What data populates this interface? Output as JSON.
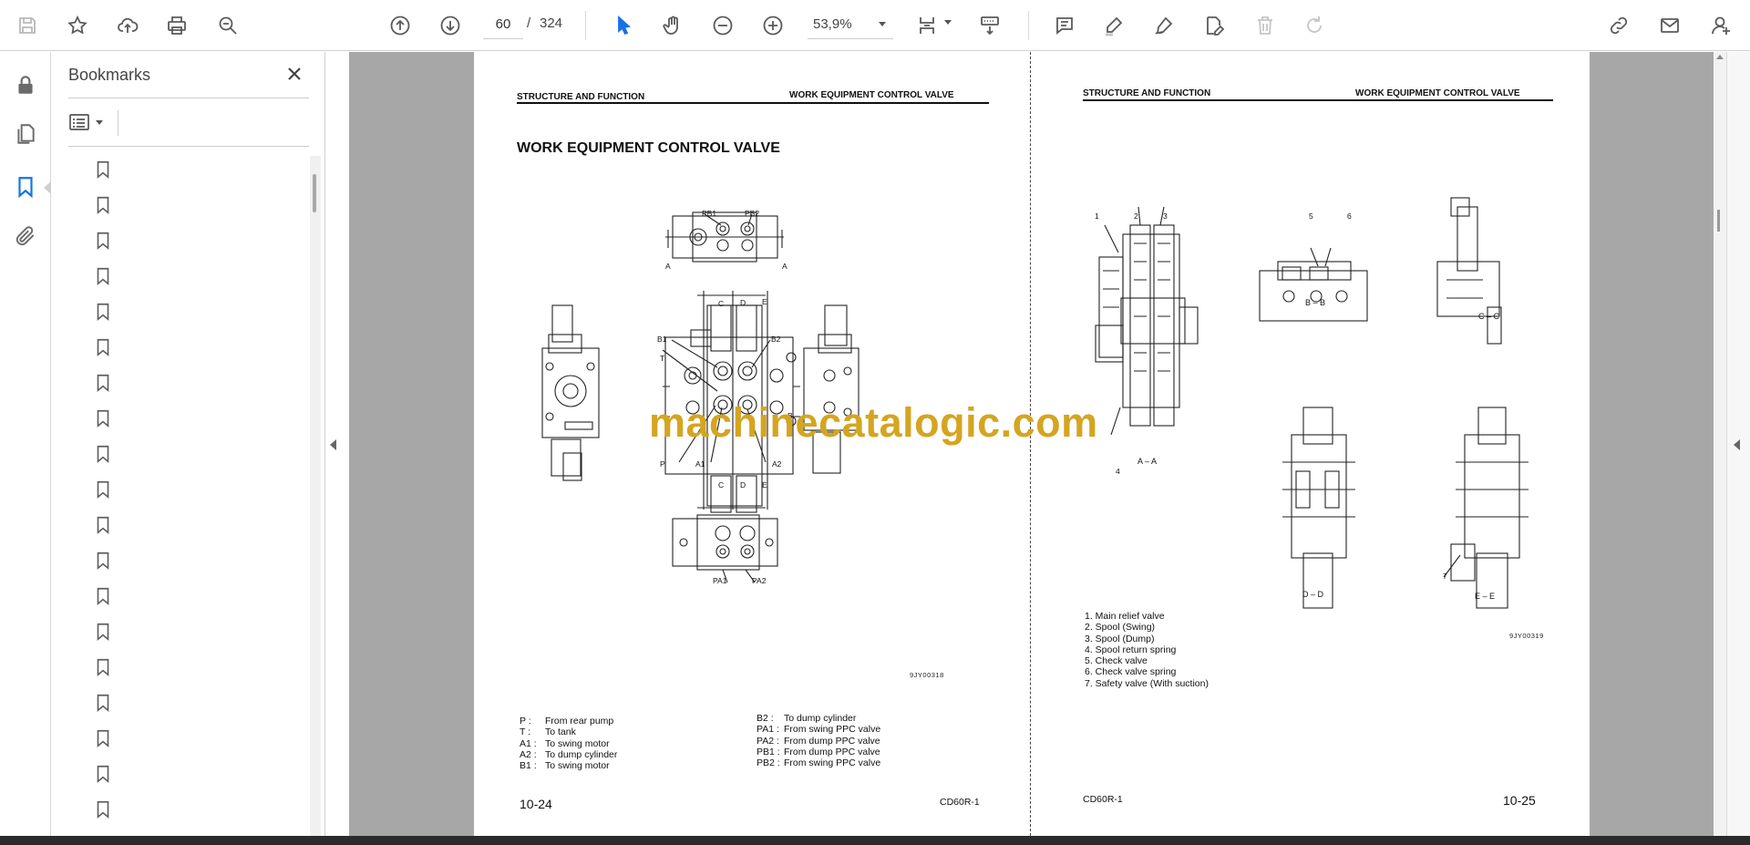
{
  "toolbar": {
    "page_current": "60",
    "page_separator": "/",
    "page_total": "324",
    "zoom": "53,9%"
  },
  "sidebar": {
    "title": "Bookmarks",
    "bookmark_count": 19
  },
  "document": {
    "left": {
      "header_left": "STRUCTURE AND FUNCTION",
      "header_right": "WORK EQUIPMENT CONTROL VALVE",
      "title": "WORK EQUIPMENT CONTROL VALVE",
      "figure_code": "9JY00318",
      "callouts": [
        "PB1",
        "PB2",
        "A",
        "A",
        "C",
        "D",
        "E",
        "B1",
        "B2",
        "T",
        "B",
        "B",
        "P",
        "A1",
        "A2",
        "C",
        "D",
        "E",
        "PA1",
        "PA2"
      ],
      "legend_left": [
        {
          "key": "P :",
          "text": "From rear pump"
        },
        {
          "key": "T :",
          "text": "To tank"
        },
        {
          "key": "A1 :",
          "text": "To swing motor"
        },
        {
          "key": "A2 :",
          "text": "To dump cylinder"
        },
        {
          "key": "B1 :",
          "text": "To swing motor"
        }
      ],
      "legend_right": [
        {
          "key": "B2 :",
          "text": "To dump cylinder"
        },
        {
          "key": "PA1 :",
          "text": "From swing PPC valve"
        },
        {
          "key": "PA2 :",
          "text": "From dump PPC valve"
        },
        {
          "key": "PB1 :",
          "text": "From dump PPC valve"
        },
        {
          "key": "PB2 :",
          "text": "From swing PPC valve"
        }
      ],
      "page_number": "10-24",
      "model": "CD60R-1"
    },
    "right": {
      "header_left": "STRUCTURE AND FUNCTION",
      "header_right": "WORK EQUIPMENT CONTROL VALVE",
      "figure_code": "9JY00319",
      "sections": [
        "A – A",
        "B – B",
        "C – C",
        "D – D",
        "E – E"
      ],
      "callouts": [
        "1",
        "2",
        "3",
        "4",
        "5",
        "6",
        "7"
      ],
      "parts": [
        "1. Main relief valve",
        "2. Spool (Swing)",
        "3. Spool (Dump)",
        "4. Spool return spring",
        "5. Check valve",
        "6. Check valve spring",
        "7. Safety valve (With suction)"
      ],
      "page_number": "10-25",
      "model": "CD60R-1"
    },
    "watermark": "machinecatalogic.com"
  }
}
